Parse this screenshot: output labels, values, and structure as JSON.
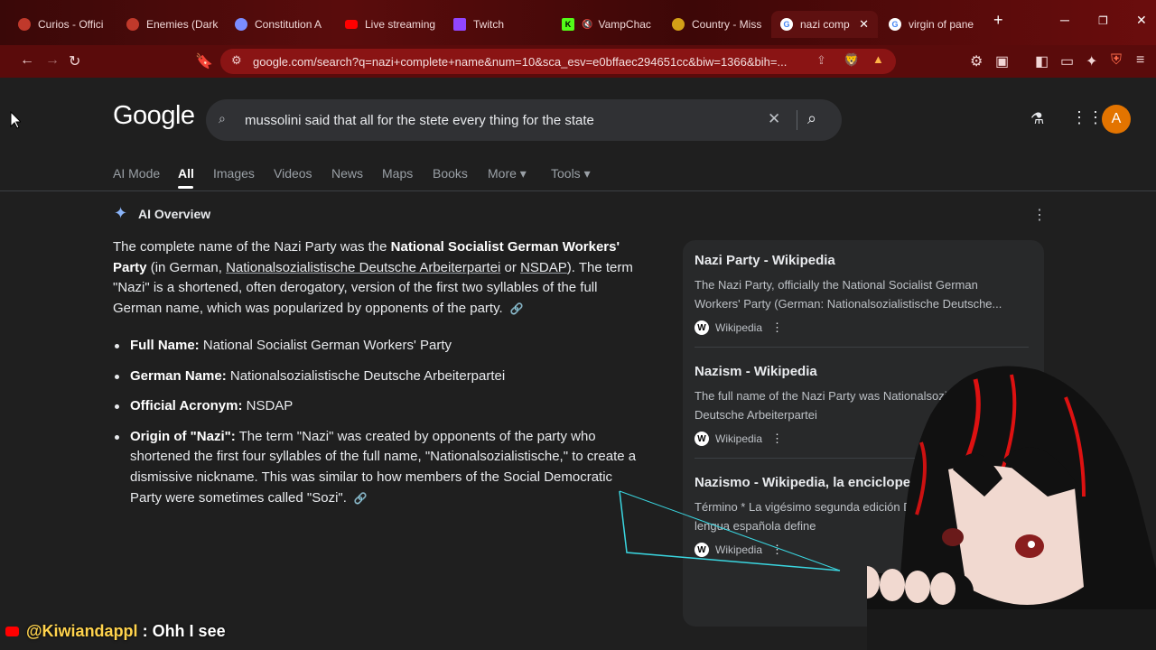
{
  "tabs": [
    {
      "title": "Curios - Offici",
      "icon": "curios-icon",
      "color": "#c0392b"
    },
    {
      "title": "Enemies (Dark",
      "icon": "enemies-icon",
      "color": "#c0392b"
    },
    {
      "title": "Constitution A",
      "icon": "chatgpt-icon",
      "color": "#7b8cff"
    },
    {
      "title": "Live streaming",
      "icon": "youtube-icon",
      "color": "#ff0000"
    },
    {
      "title": "Twitch",
      "icon": "twitch-icon",
      "color": "#9146ff"
    },
    {
      "title": "VampChac",
      "icon": "kick-icon",
      "color": "#53fc18"
    },
    {
      "title": "Country - Miss",
      "icon": "globe-icon",
      "color": "#d4a017"
    },
    {
      "title": "nazi comp",
      "icon": "google-icon",
      "color": "#4285f4"
    },
    {
      "title": "virgin of pane",
      "icon": "google-icon",
      "color": "#4285f4"
    }
  ],
  "omnibox": {
    "url": "google.com/search?q=nazi+complete+name&num=10&sca_esv=e0bffaec294651cc&biw=1366&bih=..."
  },
  "google": {
    "logo": "Google",
    "query": "mussolini said that all for the stete every thing for the state",
    "avatar_letter": "A",
    "nav": [
      "AI Mode",
      "All",
      "Images",
      "Videos",
      "News",
      "Maps",
      "Books",
      "More ▾",
      "Tools ▾"
    ]
  },
  "ai_overview": {
    "title": "AI Overview",
    "para_1": "The complete name of the Nazi Party was the ",
    "para_bold": "National Socialist German Workers' Party",
    "para_2": " (in German, ",
    "para_u1": "Nationalsozialistische Deutsche Arbeiterpartei",
    "para_3": " or ",
    "para_u2": "NSDAP",
    "para_4": "). The term \"Nazi\" is a shortened, often derogatory, version of the first two syllables of the full German name, which was popularized by opponents of the party.",
    "bullets": [
      {
        "label": "Full Name:",
        "text": " National Socialist German Workers' Party"
      },
      {
        "label": "German Name:",
        "text": " Nationalsozialistische Deutsche Arbeiterpartei"
      },
      {
        "label": "Official Acronym:",
        "text": " NSDAP"
      },
      {
        "label": "Origin of \"Nazi\":",
        "text": " The term \"Nazi\" was created by opponents of the party who shortened the first four syllables of the full name, \"Nationalsozialistische,\" to create a dismissive nickname. This was similar to how members of the Social Democratic Party were sometimes called \"Sozi\"."
      }
    ]
  },
  "sources": [
    {
      "title": "Nazi Party - Wikipedia",
      "desc": "The Nazi Party, officially the National Socialist German Workers' Party (German: Nationalsozialistische Deutsche...",
      "site": "Wikipedia"
    },
    {
      "title": "Nazism - Wikipedia",
      "desc": "The full name of the Nazi Party was Nationalsozialistische Deutsche Arbeiterpartei",
      "site": "Wikipedia"
    },
    {
      "title": "Nazismo - Wikipedia, la enciclopedi",
      "desc": "Término * La vigésimo segunda edición Diccionario de la lengua española define",
      "site": "Wikipedia"
    }
  ],
  "chat": {
    "user": "@Kiwiandappl",
    "sep": " : ",
    "message": "Ohh I see"
  }
}
